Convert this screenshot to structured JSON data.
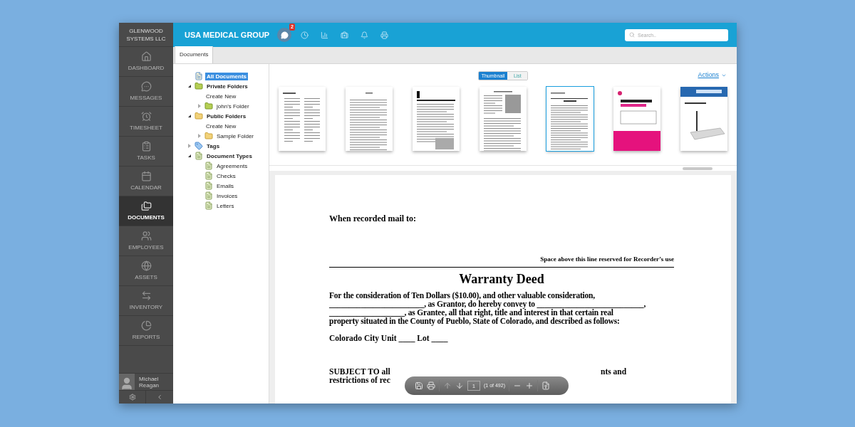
{
  "sidebar": {
    "company": "GLENWOOD SYSTEMS LLC",
    "items": [
      {
        "label": "DASHBOARD",
        "kind": "home",
        "selected": false
      },
      {
        "label": "MESSAGES",
        "kind": "messages",
        "selected": false
      },
      {
        "label": "TIMESHEET",
        "kind": "alarm",
        "selected": false
      },
      {
        "label": "TASKS",
        "kind": "tasks",
        "selected": false
      },
      {
        "label": "CALENDAR",
        "kind": "calendar",
        "selected": false
      },
      {
        "label": "DOCUMENTS",
        "kind": "folders",
        "selected": true
      },
      {
        "label": "EMPLOYEES",
        "kind": "people",
        "selected": false
      },
      {
        "label": "ASSETS",
        "kind": "globe",
        "selected": false
      },
      {
        "label": "INVENTORY",
        "kind": "transfer",
        "selected": false
      },
      {
        "label": "REPORTS",
        "kind": "pie",
        "selected": false
      }
    ],
    "user": {
      "name": "Michael Reagan"
    }
  },
  "header": {
    "title": "USA MEDICAL GROUP",
    "icons": [
      {
        "kind": "chat",
        "badge": "2",
        "selected": true
      },
      {
        "kind": "clock",
        "selected": false
      },
      {
        "kind": "chart",
        "selected": false
      },
      {
        "kind": "kit",
        "selected": false
      },
      {
        "kind": "bell",
        "selected": false
      },
      {
        "kind": "printer",
        "selected": false
      }
    ],
    "search": {
      "placeholder": "Search.."
    }
  },
  "tabs": [
    {
      "label": "Documents",
      "selected": true
    }
  ],
  "tree": [
    {
      "label": "All Documents",
      "kind": "root",
      "selected": true
    },
    {
      "label": "Private Folders",
      "kind": "private_folder",
      "selected": false,
      "expanded": true,
      "children": [
        {
          "label": "Create New",
          "kind": "action",
          "selected": false
        },
        {
          "label": "john's Folder",
          "kind": "private_folder",
          "selected": false,
          "expanded": false
        }
      ]
    },
    {
      "label": "Public Folders",
      "kind": "public_folder",
      "selected": false,
      "expanded": true,
      "children": [
        {
          "label": "Create New",
          "kind": "action",
          "selected": false
        },
        {
          "label": "Sample Folder",
          "kind": "public_folder",
          "selected": false,
          "expanded": false
        }
      ]
    },
    {
      "label": "Tags",
      "kind": "tag",
      "selected": false,
      "expanded": false
    },
    {
      "label": "Document Types",
      "kind": "doc_type",
      "selected": false,
      "expanded": true,
      "children": [
        {
          "label": "Agreements",
          "kind": "doc_type",
          "selected": false
        },
        {
          "label": "Checks",
          "kind": "doc_type",
          "selected": false
        },
        {
          "label": "Emails",
          "kind": "doc_type",
          "selected": false
        },
        {
          "label": "Invoices",
          "kind": "doc_type",
          "selected": false
        },
        {
          "label": "Letters",
          "kind": "doc_type",
          "selected": false
        }
      ]
    }
  ],
  "view_toggle": [
    {
      "label": "Thumbnail",
      "selected": true
    },
    {
      "label": "List",
      "selected": false
    }
  ],
  "actions": {
    "label": "Actions"
  },
  "thumbnails": [
    {
      "kind": "toc",
      "selected": false
    },
    {
      "kind": "letter",
      "selected": false
    },
    {
      "kind": "chapter",
      "selected": false
    },
    {
      "kind": "columns",
      "selected": false
    },
    {
      "kind": "form",
      "selected": true
    },
    {
      "kind": "manual",
      "selected": false
    },
    {
      "kind": "router",
      "selected": false
    }
  ],
  "document": {
    "mail_to": "When recorded mail to:",
    "reserved": "Space above this line reserved for Recorder’s use",
    "title": "Warranty Deed",
    "paragraph": [
      "For the consideration of Ten Dollars ($10.00), and other valuable consideration,",
      "________________________, as Grantor, do hereby convey to ___________________________,",
      "___________________, as Grantee, all that right, title and interest in that certain real",
      "property situated in the County of Pueblo, State of Colorado, and described as follows:"
    ],
    "unit": "Colorado City Unit ____ Lot ____",
    "subject_left": [
      "SUBJECT TO all",
      "restrictions of rec"
    ],
    "subject_right": "nts and"
  },
  "viewer_toolbar": {
    "page": "1",
    "count": "(1 of 492)"
  }
}
